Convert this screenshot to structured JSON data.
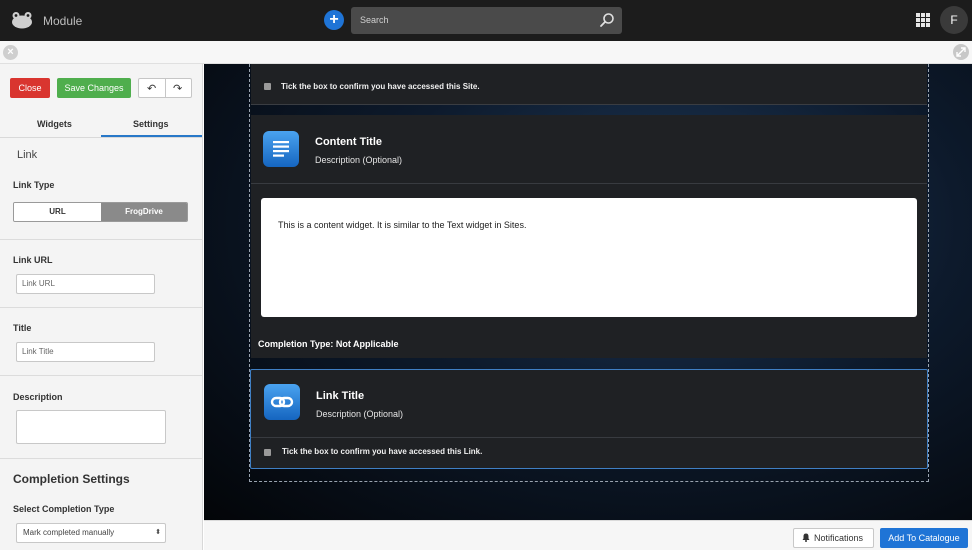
{
  "topbar": {
    "app_title": "Module",
    "search_placeholder": "Search",
    "avatar_initial": "F",
    "add_symbol": "+"
  },
  "subbar": {
    "close_symbol": "×"
  },
  "panel": {
    "close_label": "Close",
    "save_label": "Save Changes",
    "undo_symbol": "↶",
    "redo_symbol": "↷",
    "tabs": [
      "Widgets",
      "Settings"
    ],
    "active_tab": "Settings",
    "section_title": "Link",
    "link_type_label": "Link Type",
    "link_type_options": [
      "URL",
      "FrogDrive"
    ],
    "link_url_label": "Link URL",
    "link_url_placeholder": "Link URL",
    "title_label": "Title",
    "title_placeholder": "Link Title",
    "description_label": "Description",
    "completion_heading": "Completion Settings",
    "completion_type_label": "Select Completion Type",
    "completion_type_value": "Mark completed manually",
    "select_arrows": "⬍"
  },
  "main": {
    "site_widget": {
      "checkbox_text": "Tick the box to confirm you have accessed this Site."
    },
    "content_widget": {
      "title": "Content Title",
      "description": "Description (Optional)",
      "body": "This is a content widget. It is similar to the Text widget in Sites.",
      "completion_type": "Completion Type: Not Applicable"
    },
    "link_widget": {
      "title": "Link Title",
      "description": "Description (Optional)",
      "checkbox_text": "Tick the box to confirm you have accessed this Link."
    }
  },
  "footer": {
    "notifications_label": "Notifications",
    "catalogue_label": "Add To Catalogue"
  },
  "colors": {
    "accent_blue": "#1f74d6",
    "close_red": "#d9352f",
    "save_green": "#4fae4d",
    "active_tab_underline": "#2878c8",
    "selected_card_border": "#3f7fc4"
  },
  "icons": [
    "frog-logo-icon",
    "plus-icon",
    "search-icon",
    "apps-grid-icon",
    "close-icon",
    "expand-icon",
    "undo-icon",
    "redo-icon",
    "document-lines-icon",
    "link-chain-icon",
    "bell-icon",
    "select-arrows-icon"
  ]
}
